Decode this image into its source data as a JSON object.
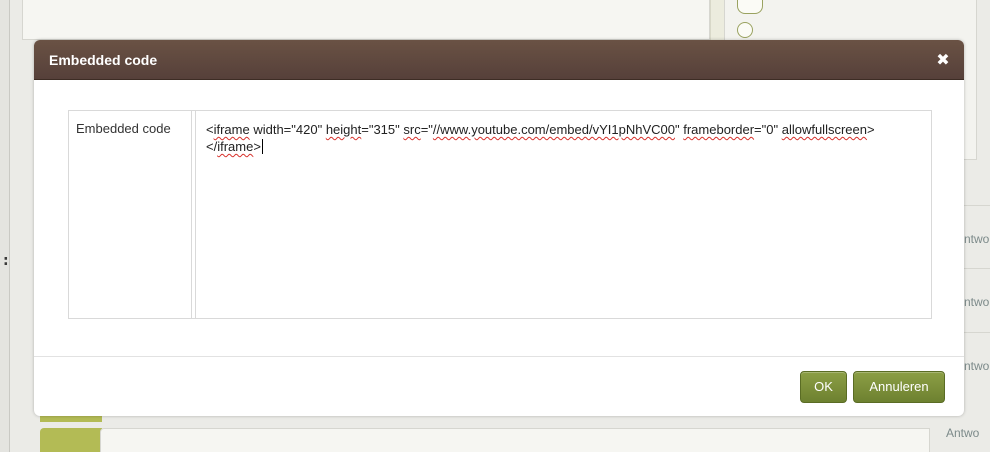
{
  "background": {
    "colon": ":",
    "antwo_labels": [
      "Antwo",
      "Antwo",
      "Antwo"
    ],
    "antwo_last": "Antwo"
  },
  "dialog": {
    "title": "Embedded code",
    "close_icon": "close-icon",
    "field": {
      "label": "Embedded code",
      "value": "<iframe width=\"420\" height=\"315\" src=\"//www.youtube.com/embed/vYI1pNhVC00\" frameborder=\"0\" allowfullscreen></iframe>"
    },
    "buttons": {
      "ok": "OK",
      "cancel": "Annuleren"
    }
  },
  "colors": {
    "header": "#5e463d",
    "button": "#7a8e38",
    "antwo_text": "#7c8a8a"
  }
}
